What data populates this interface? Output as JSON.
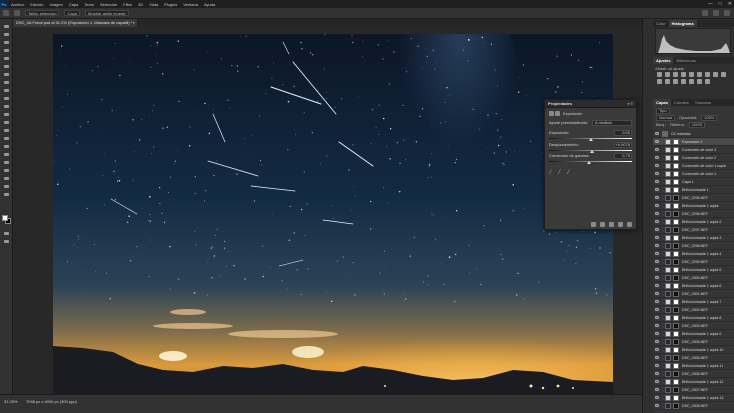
{
  "menubar": {
    "logo": "Ps",
    "items": [
      "Archivo",
      "Edición",
      "Imagen",
      "Capa",
      "Texto",
      "Selección",
      "Filtro",
      "3D",
      "Vista",
      "Plugins",
      "Ventana",
      "Ayuda"
    ],
    "win_min": "—",
    "win_max": "□",
    "win_close": "✕"
  },
  "options": {
    "blend_label": "Tabla: selección",
    "blend_value": "Capa",
    "sample_label": "Mostrar anillo muestr."
  },
  "document_tab": {
    "title": "DSC_0A Foto#.psd al 31,2% (Exposición 1, Máscara de capa/8) *",
    "close": "×"
  },
  "status": {
    "zoom": "31,25%",
    "doc_size": "7048 px x 4000 px (300 ppp)"
  },
  "properties": {
    "title": "Propiedades",
    "close": "»  ≡",
    "adjustment_name": "Exposición",
    "preset_label": "Ajuste preestablecido:",
    "preset_value": "A medida",
    "exposure_label": "Exposición:",
    "exposure_value": "0,00",
    "exposure_level": 0.5,
    "offset_label": "Desplazamiento:",
    "offset_value": "+0,0078",
    "offset_level": 0.52,
    "gamma_label": "Corrección de gamma:",
    "gamma_value": "0,75",
    "gamma_level": 0.48
  },
  "dock": {
    "tabs_top": [
      "Color",
      "Histograma"
    ],
    "tabs_adj": [
      "Ajustes",
      "Bibliotecas"
    ],
    "adj_label": "Añadir un ajuste",
    "tabs_layers": [
      "Capas",
      "Canales",
      "Trazados"
    ],
    "kind_label": "Tipo",
    "blend_mode": "Normal",
    "opacity_label": "Opacidad:",
    "opacity_value": "100%",
    "lock_label": "Bloq.:",
    "fill_label": "Relleno:",
    "fill_value": "100%",
    "layers": [
      {
        "name": "CC estrellas",
        "group": true
      },
      {
        "name": "Exposición 1",
        "selected": true
      },
      {
        "name": "Corrección de color 3"
      },
      {
        "name": "Corrección de color 2"
      },
      {
        "name": "Corrección de color 1 copia"
      },
      {
        "name": "Corrección de color 1"
      },
      {
        "name": "Capa 1"
      },
      {
        "name": "Brillo/contraste 1"
      },
      {
        "name": "DSC_0295.NEF"
      },
      {
        "name": "Brillo/contraste 1 copia"
      },
      {
        "name": "DSC_0296.NEF"
      },
      {
        "name": "Brillo/contraste 1 copia 2"
      },
      {
        "name": "DSC_0297.NEF"
      },
      {
        "name": "Brillo/contraste 1 copia 3"
      },
      {
        "name": "DSC_0298.NEF"
      },
      {
        "name": "Brillo/contraste 1 copia 4"
      },
      {
        "name": "DSC_0299.NEF"
      },
      {
        "name": "Brillo/contraste 1 copia 5"
      },
      {
        "name": "DSC_0300.NEF"
      },
      {
        "name": "Brillo/contraste 1 copia 6"
      },
      {
        "name": "DSC_0301.NEF"
      },
      {
        "name": "Brillo/contraste 1 copia 7"
      },
      {
        "name": "DSC_0302.NEF"
      },
      {
        "name": "Brillo/contraste 1 copia 8"
      },
      {
        "name": "DSC_0303.NEF"
      },
      {
        "name": "Brillo/contraste 1 copia 9"
      },
      {
        "name": "DSC_0304.NEF"
      },
      {
        "name": "Brillo/contraste 1 copia 10"
      },
      {
        "name": "DSC_0305.NEF"
      },
      {
        "name": "Brillo/contraste 1 copia 11"
      },
      {
        "name": "DSC_0306.NEF"
      },
      {
        "name": "Brillo/contraste 1 copia 12"
      },
      {
        "name": "DSC_0307.NEF"
      },
      {
        "name": "Brillo/contraste 1 copia 13"
      },
      {
        "name": "DSC_0308.NEF"
      }
    ]
  }
}
